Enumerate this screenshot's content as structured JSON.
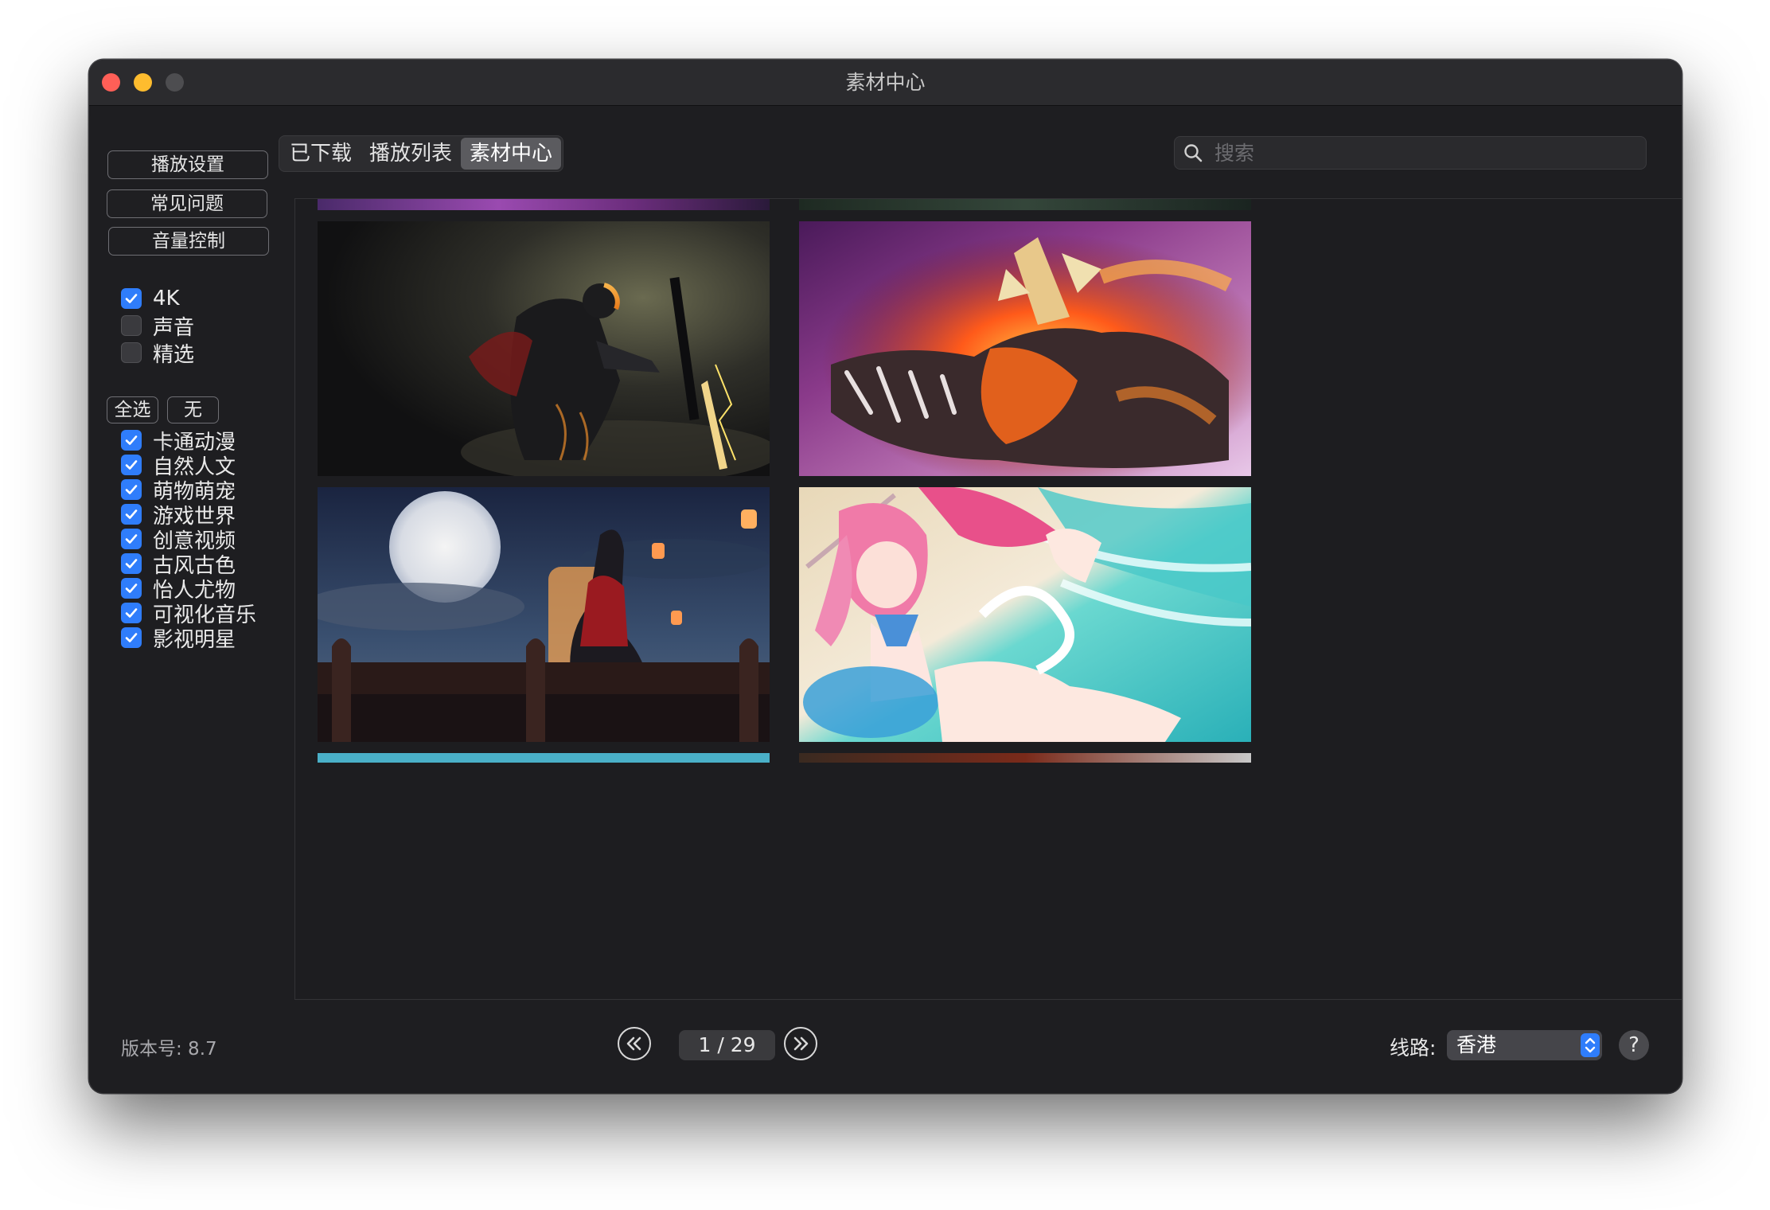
{
  "window": {
    "title": "素材中心"
  },
  "tabs": [
    {
      "label": "已下载",
      "active": false
    },
    {
      "label": "播放列表",
      "active": false
    },
    {
      "label": "素材中心",
      "active": true
    }
  ],
  "search": {
    "placeholder": "搜索",
    "value": ""
  },
  "sidebar": {
    "buttons": [
      "播放设置",
      "常见问题",
      "音量控制"
    ],
    "filters": [
      {
        "label": "4K",
        "checked": true
      },
      {
        "label": "声音",
        "checked": false
      },
      {
        "label": "精选",
        "checked": false
      }
    ],
    "select_all_label": "全选",
    "select_none_label": "无",
    "categories": [
      {
        "label": "卡通动漫",
        "checked": true
      },
      {
        "label": "自然人文",
        "checked": true
      },
      {
        "label": "萌物萌宠",
        "checked": true
      },
      {
        "label": "游戏世界",
        "checked": true
      },
      {
        "label": "创意视频",
        "checked": true
      },
      {
        "label": "古风古色",
        "checked": true
      },
      {
        "label": "怡人尤物",
        "checked": true
      },
      {
        "label": "可视化音乐",
        "checked": true
      },
      {
        "label": "影视明星",
        "checked": true
      }
    ]
  },
  "gallery": {
    "thumbnails": [
      {
        "subject": "dark-armored-knight-sword"
      },
      {
        "subject": "fire-mecha-dragon"
      },
      {
        "subject": "moon-lantern-warrior-woman"
      },
      {
        "subject": "pink-hair-anime-girl-beach"
      }
    ]
  },
  "footer": {
    "version": "版本号: 8.7",
    "page": "1 / 29",
    "route_label": "线路:",
    "route_value": "香港",
    "help_label": "?"
  },
  "colors": {
    "accent": "#2f7dfb",
    "window_bg": "#1e1e21",
    "traffic_red": "#ff5f57",
    "traffic_yellow": "#febc2e"
  }
}
